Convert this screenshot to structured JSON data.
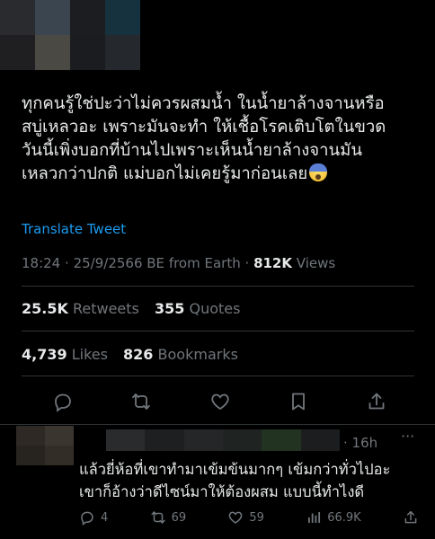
{
  "colors": {
    "background": "#000000",
    "text": "#e7e9ea",
    "secondary": "#71767b",
    "link": "#1d9bf0",
    "divider": "#2f3336"
  },
  "author": {
    "avatar_blocks": [
      "#2a2b2e",
      "#3a4550",
      "#1c1d20",
      "#16323f",
      "#1f1f22",
      "#222327",
      "#1b1c1f",
      "#25282c",
      "#242528",
      "#2f3033",
      "#4a4944",
      "#2b2c2f"
    ]
  },
  "tweet": {
    "text": "ทุกคนรู้ใช่ปะว่าไม่ควรผสมน้ำ ในน้ำยาล้างจานหรือ\nสบู่เหลวอะ เพราะมันจะทำ ให้เชื้อโรคเติบโตในขวด\nวันนี้เพิ่งบอกที่บ้านไปเพราะเห็นน้ำยาล้างจานมัน\nเหลวกว่าปกติ แม่บอกไม่เคยรู้มาก่อนเลย",
    "emoji": "fearful-face-emoji",
    "translate_label": "Translate Tweet",
    "time": "18:24",
    "date": "25/9/2566 BE",
    "source": "from Earth",
    "views_count": "812K",
    "views_label": "Views",
    "retweets_count": "25.5K",
    "retweets_label": "Retweets",
    "quotes_count": "355",
    "quotes_label": "Quotes",
    "likes_count": "4,739",
    "likes_label": "Likes",
    "bookmarks_count": "826",
    "bookmarks_label": "Bookmarks"
  },
  "actions": [
    "reply-icon",
    "retweet-icon",
    "like-icon",
    "bookmark-icon",
    "share-icon"
  ],
  "reply": {
    "time": "· 16h",
    "more": "···",
    "text": "แล้วยี่ห้อที่เขาทำมาเข้มข้นมากๆ เข้มกว่าทั่วไปอะ\nเขาก็อ้างว่าดีไซน์มาให้ต้องผสม แบบนี้ทำไงดี",
    "replies": "4",
    "retweets": "69",
    "likes": "59",
    "views": "66.9K"
  }
}
